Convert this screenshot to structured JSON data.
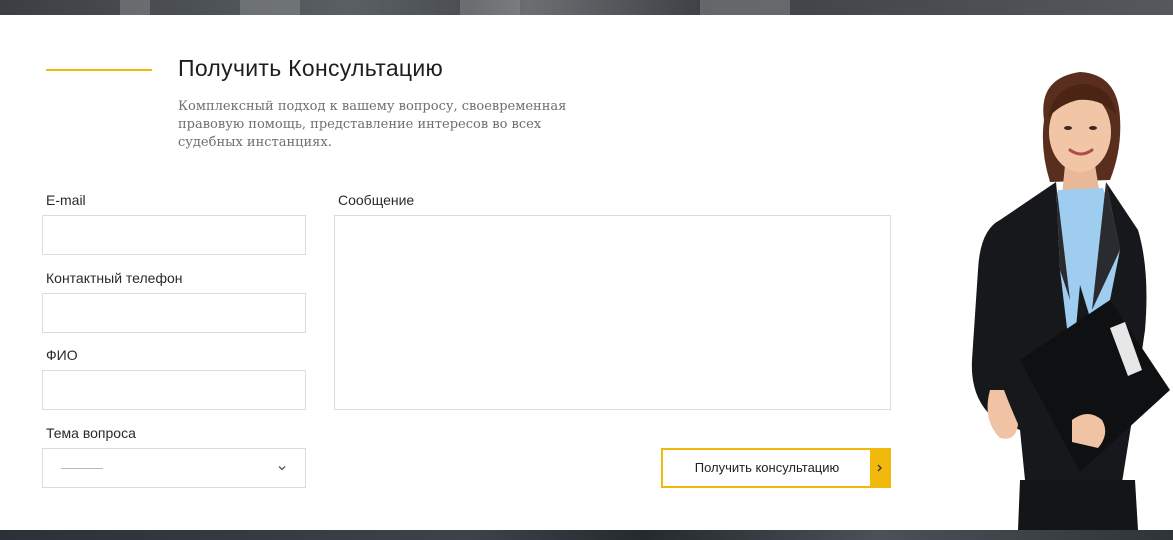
{
  "header": {
    "title": "Получить Консультацию",
    "subtitle": "Комплексный подход к вашему вопросу, своевременная правовую помощь, представление интересов во всех судебных инстанциях."
  },
  "form": {
    "email_label": "E-mail",
    "phone_label": "Контактный телефон",
    "name_label": "ФИО",
    "topic_label": "Тема вопроса",
    "topic_selected": "",
    "message_label": "Сообщение",
    "submit_label": "Получить консультацию"
  },
  "colors": {
    "accent": "#f0b90b",
    "border": "#dcdcdc",
    "text": "#222222",
    "muted": "#6e6e6e"
  },
  "icons": {
    "select_arrow": "chevron-down-icon",
    "submit_arrow": "chevron-right-icon"
  }
}
